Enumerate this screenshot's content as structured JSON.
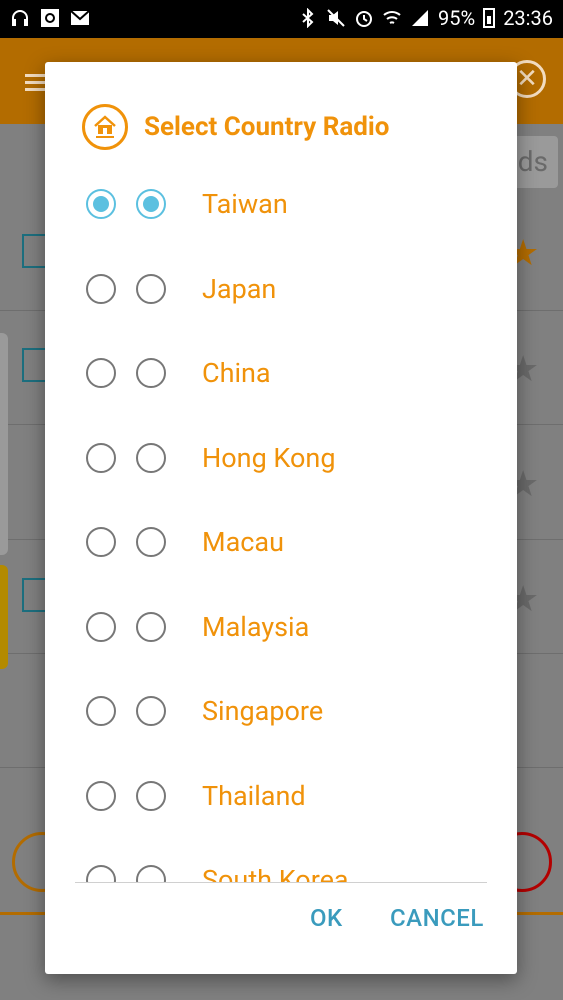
{
  "status_bar": {
    "battery": "95%",
    "time": "23:36"
  },
  "dialog": {
    "title": "Select Country Radio",
    "countries": [
      {
        "name": "Taiwan",
        "selected": true
      },
      {
        "name": "Japan",
        "selected": false
      },
      {
        "name": "China",
        "selected": false
      },
      {
        "name": "Hong Kong",
        "selected": false
      },
      {
        "name": "Macau",
        "selected": false
      },
      {
        "name": "Malaysia",
        "selected": false
      },
      {
        "name": "Singapore",
        "selected": false
      },
      {
        "name": "Thailand",
        "selected": false
      },
      {
        "name": "South Korea",
        "selected": false
      }
    ],
    "ok_label": "OK",
    "cancel_label": "CANCEL"
  },
  "background": {
    "tab_fragment": "ds"
  },
  "colors": {
    "accent": "#f0920a",
    "radio_selected": "#5bc0e0",
    "button_text": "#3a9bbd",
    "app_bar": "#b36c00"
  }
}
